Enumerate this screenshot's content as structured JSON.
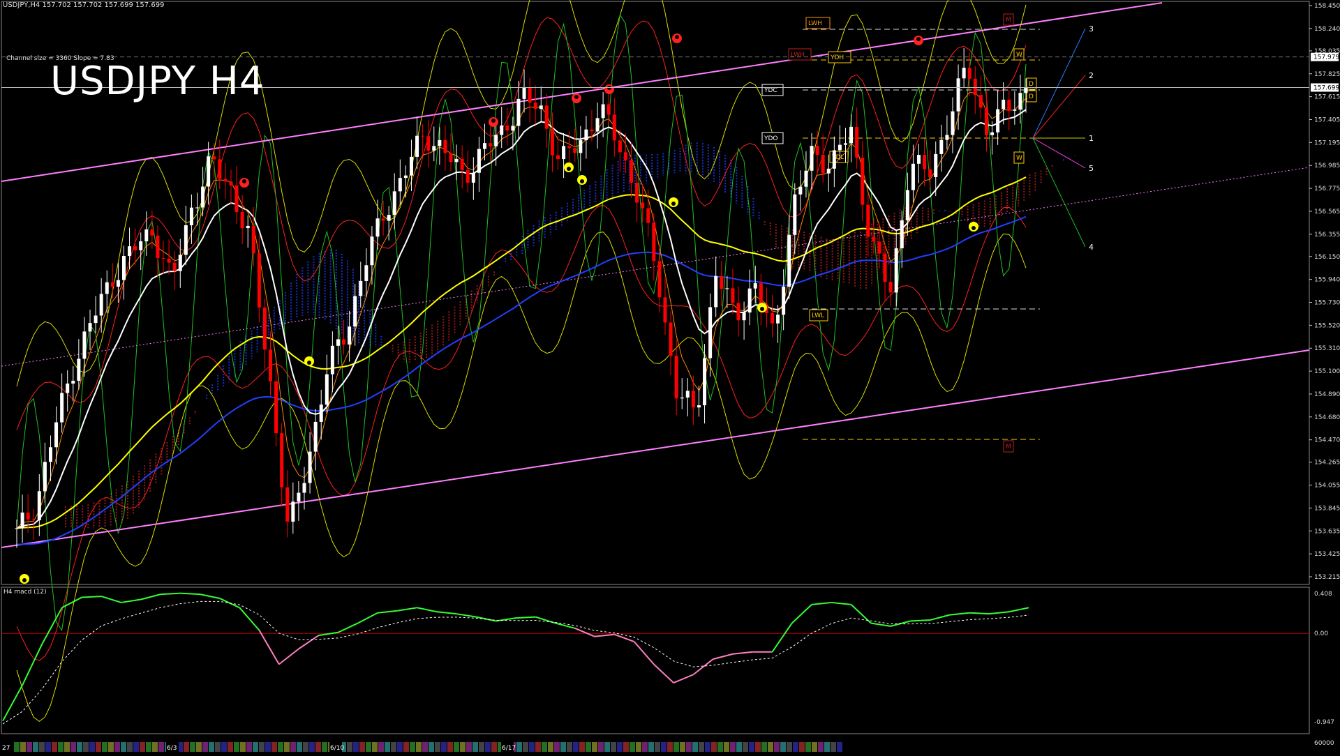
{
  "header": {
    "info": "USDJPY,H4  157.702 157.702 157.699 157.699",
    "channel_info": "Channel size = 3360 Slope = 7.83",
    "title": "USDJPY H4"
  },
  "macd": {
    "title": "H4  macd (12)",
    "axis_labels": [
      "0.408",
      "0.00",
      "-0.947",
      "60000"
    ]
  },
  "colors": {
    "background": "#000000",
    "candle_up": "#ffffff",
    "candle_down": "#ff0000",
    "channel": "#ff80ff",
    "cloud": "#1e3cff",
    "ma_slow": "#ffff00",
    "ma_fast": "#ffffff",
    "macd_main": "#33ff33",
    "macd_neg": "#ff80c0",
    "macd_signal": "#ffffff",
    "level_box": "#ffcc00",
    "fractal_up": "#ffff00",
    "fractal_down": "#ff2020"
  },
  "chart_data": {
    "type": "candlestick",
    "symbol": "USDJPY",
    "timeframe": "H4",
    "ylim": [
      153.215,
      158.45
    ],
    "y_ticks": [
      "158.450",
      "158.240",
      "158.035",
      "157.825",
      "157.615",
      "157.405",
      "157.195",
      "156.985",
      "156.775",
      "156.565",
      "156.355",
      "156.150",
      "155.940",
      "155.730",
      "155.520",
      "155.310",
      "155.100",
      "154.890",
      "154.680",
      "154.470",
      "154.265",
      "154.055",
      "153.845",
      "153.635",
      "153.425",
      "153.215"
    ],
    "current_price_labels": [
      "157.979",
      "157.699"
    ],
    "x_labels": [
      "27",
      "6/3",
      "6/10",
      "6/17"
    ],
    "close_path": [
      153.6,
      153.9,
      154.6,
      155.2,
      155.6,
      156.0,
      156.2,
      156.4,
      155.9,
      156.6,
      157.0,
      156.8,
      156.3,
      155.1,
      153.6,
      154.3,
      155.1,
      155.5,
      156.1,
      156.6,
      156.9,
      157.3,
      157.1,
      156.9,
      157.1,
      157.3,
      157.6,
      157.5,
      157.0,
      157.2,
      157.5,
      157.2,
      156.7,
      156.0,
      154.9,
      154.7,
      156.0,
      155.6,
      155.9,
      155.4,
      156.6,
      157.1,
      157.0,
      157.3,
      156.3,
      155.8,
      157.0,
      156.9,
      157.4,
      157.9,
      157.3,
      157.5,
      157.7
    ],
    "macd": [
      -0.85,
      -0.5,
      -0.1,
      0.25,
      0.35,
      0.36,
      0.3,
      0.33,
      0.38,
      0.39,
      0.38,
      0.34,
      0.25,
      0.03,
      -0.3,
      -0.15,
      -0.02,
      0.01,
      0.1,
      0.2,
      0.22,
      0.25,
      0.21,
      0.19,
      0.16,
      0.12,
      0.15,
      0.16,
      0.1,
      0.05,
      -0.03,
      -0.01,
      -0.08,
      -0.3,
      -0.48,
      -0.4,
      -0.25,
      -0.2,
      -0.18,
      -0.18,
      0.1,
      0.28,
      0.3,
      0.28,
      0.1,
      0.07,
      0.12,
      0.13,
      0.18,
      0.2,
      0.19,
      0.21,
      0.25
    ],
    "level_labels": [
      "LWH",
      "LWH",
      "YDH",
      "YDC",
      "YDO",
      "YDL",
      "LWL",
      "W",
      "W",
      "D",
      "D",
      "M",
      "M"
    ],
    "projection_labels": [
      "3",
      "2",
      "1",
      "5",
      "4"
    ]
  }
}
